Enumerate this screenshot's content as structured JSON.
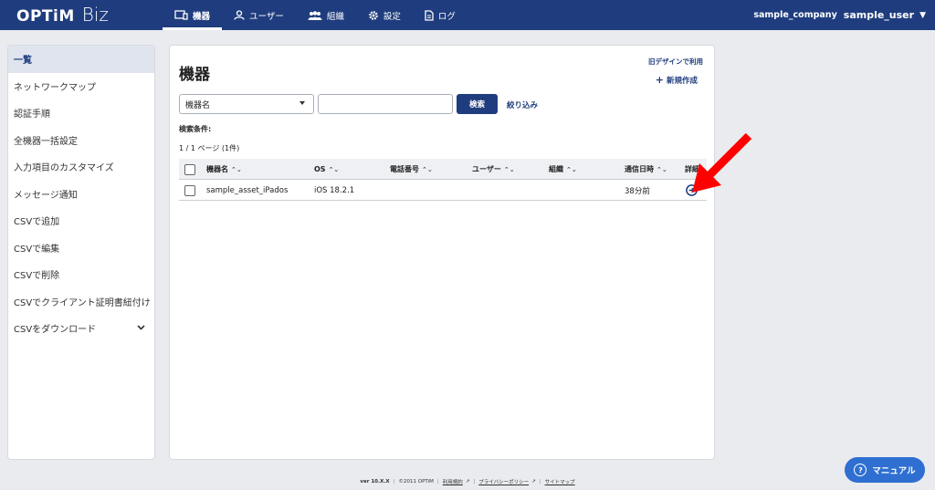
{
  "header": {
    "logo_main": "OPTiM",
    "logo_sub": "Biz",
    "nav": [
      {
        "label": "機器",
        "icon": "device-icon"
      },
      {
        "label": "ユーザー",
        "icon": "user-icon"
      },
      {
        "label": "組織",
        "icon": "organization-icon"
      },
      {
        "label": "設定",
        "icon": "gear-icon"
      },
      {
        "label": "ログ",
        "icon": "log-icon"
      }
    ],
    "company": "sample_company",
    "user": "sample_user",
    "colors": {
      "bar": "#1f3d7e"
    }
  },
  "sidebar": {
    "items": [
      {
        "label": "一覧"
      },
      {
        "label": "ネットワークマップ"
      },
      {
        "label": "認証手順"
      },
      {
        "label": "全機器一括設定"
      },
      {
        "label": "入力項目のカスタマイズ"
      },
      {
        "label": "メッセージ通知"
      },
      {
        "label": "CSVで追加"
      },
      {
        "label": "CSVで編集"
      },
      {
        "label": "CSVで削除"
      },
      {
        "label": "CSVでクライアント証明書紐付け"
      },
      {
        "label": "CSVをダウンロード"
      }
    ]
  },
  "main": {
    "title": "機器",
    "old_design": "旧デザインで利用",
    "new_button": "新規作成",
    "search": {
      "select_value": "機器名",
      "input_value": "",
      "button": "検索",
      "filter": "絞り込み"
    },
    "conditions_label": "検索条件:",
    "page_count": "1 / 1 ページ (1件)",
    "table": {
      "columns": [
        "機器名",
        "OS",
        "電話番号",
        "ユーザー",
        "組織",
        "通信日時",
        "詳細"
      ],
      "rows": [
        {
          "name": "sample_asset_iPados",
          "os": "iOS 18.2.1",
          "phone": "",
          "user": "",
          "org": "",
          "last_comm": "38分前"
        }
      ]
    }
  },
  "footer": {
    "version": "ver 10.X.X",
    "copyright": "©2011 OPTiM",
    "links": [
      "利用規約",
      "プライバシーポリシー",
      "サイトマップ"
    ]
  },
  "manual_button": "マニュアル"
}
